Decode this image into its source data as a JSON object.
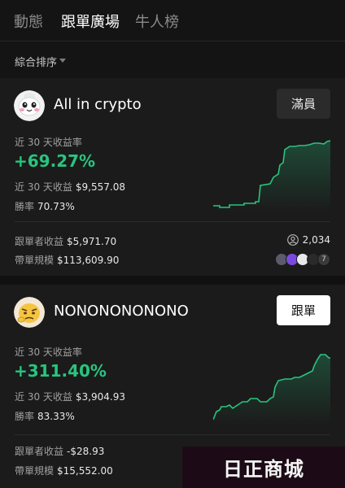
{
  "tabs": [
    "動態",
    "跟單廣場",
    "牛人榜"
  ],
  "sort": {
    "label": "綜合排序"
  },
  "traders": [
    {
      "name": "All in crypto",
      "button": "滿員",
      "period_label": "近 30 天收益率",
      "roi": "+69.27%",
      "pnl_label": "近 30 天收益",
      "pnl": "$9,557.08",
      "winrate_label": "勝率",
      "winrate": "70.73%",
      "follower_pnl_label": "跟單者收益",
      "follower_pnl": "$5,971.70",
      "aum_label": "帶單規模",
      "aum": "$113,609.90",
      "followers": "2,034",
      "more_coins": "7"
    },
    {
      "name": "NONONONONONO",
      "button": "跟單",
      "period_label": "近 30 天收益率",
      "roi": "+311.40%",
      "pnl_label": "近 30 天收益",
      "pnl": "$3,904.93",
      "winrate_label": "勝率",
      "winrate": "83.33%",
      "follower_pnl_label": "跟單者收益",
      "follower_pnl": "-$28.93",
      "aum_label": "帶單規模",
      "aum": "$15,552.00"
    }
  ],
  "watermark": "日正商城",
  "colors": {
    "positive": "#29c47f",
    "background": "#151515",
    "card": "#1b1b1b"
  }
}
